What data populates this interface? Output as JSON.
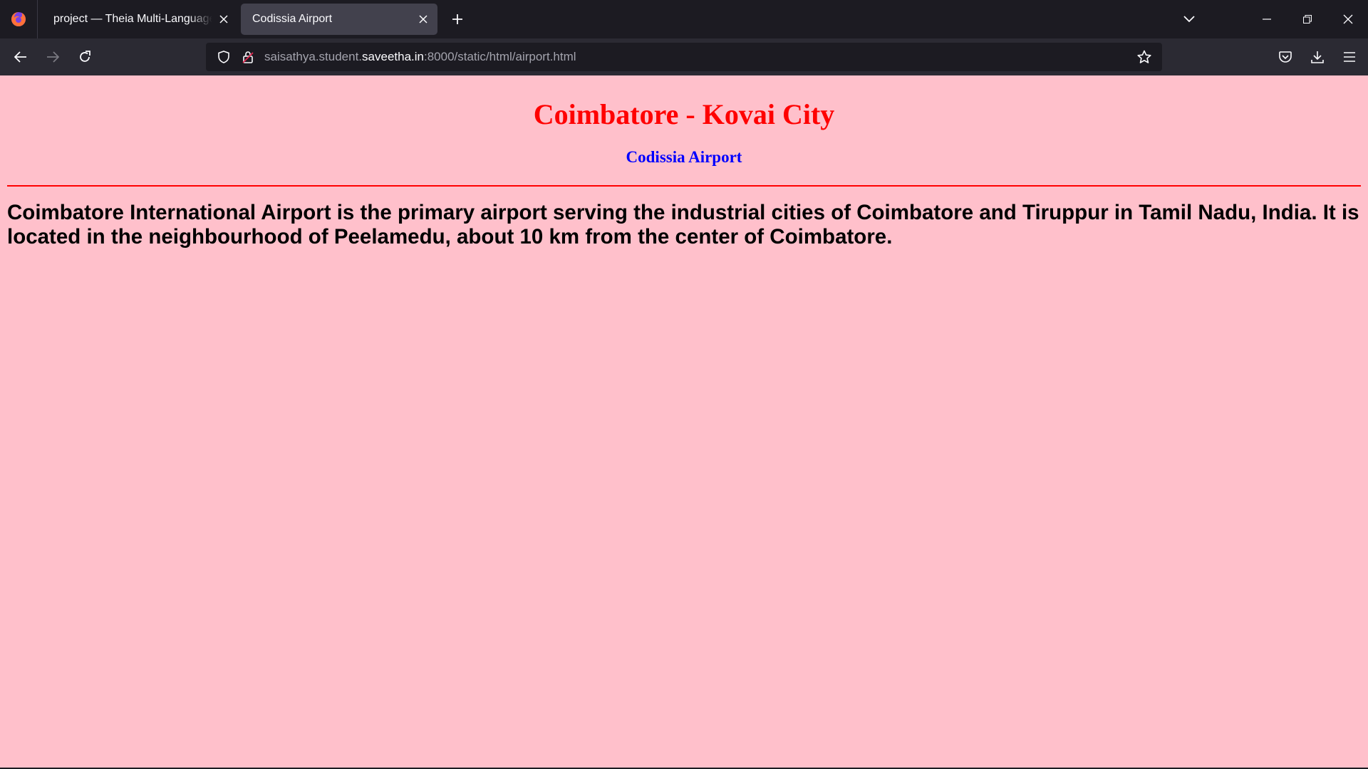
{
  "browser": {
    "tabs": [
      {
        "title": "project — Theia Multi-Language Ex",
        "active": false
      },
      {
        "title": "Codissia Airport",
        "active": true
      }
    ],
    "url": {
      "prefix": "saisathya.student.",
      "domain": "saveetha.in",
      "suffix": ":8000/static/html/airport.html"
    },
    "icons": {
      "logo": "firefox-icon",
      "close": "close-icon",
      "new_tab": "plus-icon",
      "list_all_tabs": "chevron-down-icon",
      "minimize": "minimize-icon",
      "restore": "restore-icon",
      "window_close": "close-icon",
      "back": "back-arrow-icon",
      "forward": "forward-arrow-icon",
      "reload": "reload-icon",
      "tracking": "shield-icon",
      "site_info": "lock-icon",
      "bookmark": "star-icon",
      "pocket": "pocket-icon",
      "downloads": "download-icon",
      "menu": "hamburger-menu-icon"
    },
    "colors": {
      "chrome_dark": "#1c1b22",
      "toolbar": "#2b2a33",
      "active_tab": "#42414d"
    }
  },
  "page": {
    "heading": "Coimbatore - Kovai City",
    "subheading": "Codissia Airport",
    "paragraph": "Coimbatore International Airport is the primary airport serving the industrial cities of Coimbatore and Tiruppur in Tamil Nadu, India. It is located in the neighbourhood of Peelamedu, about 10 km from the center of Coimbatore.",
    "colors": {
      "background": "#ffc0cb",
      "heading": "#ff0000",
      "subheading": "#0000ff",
      "rule": "#ff0000"
    }
  }
}
